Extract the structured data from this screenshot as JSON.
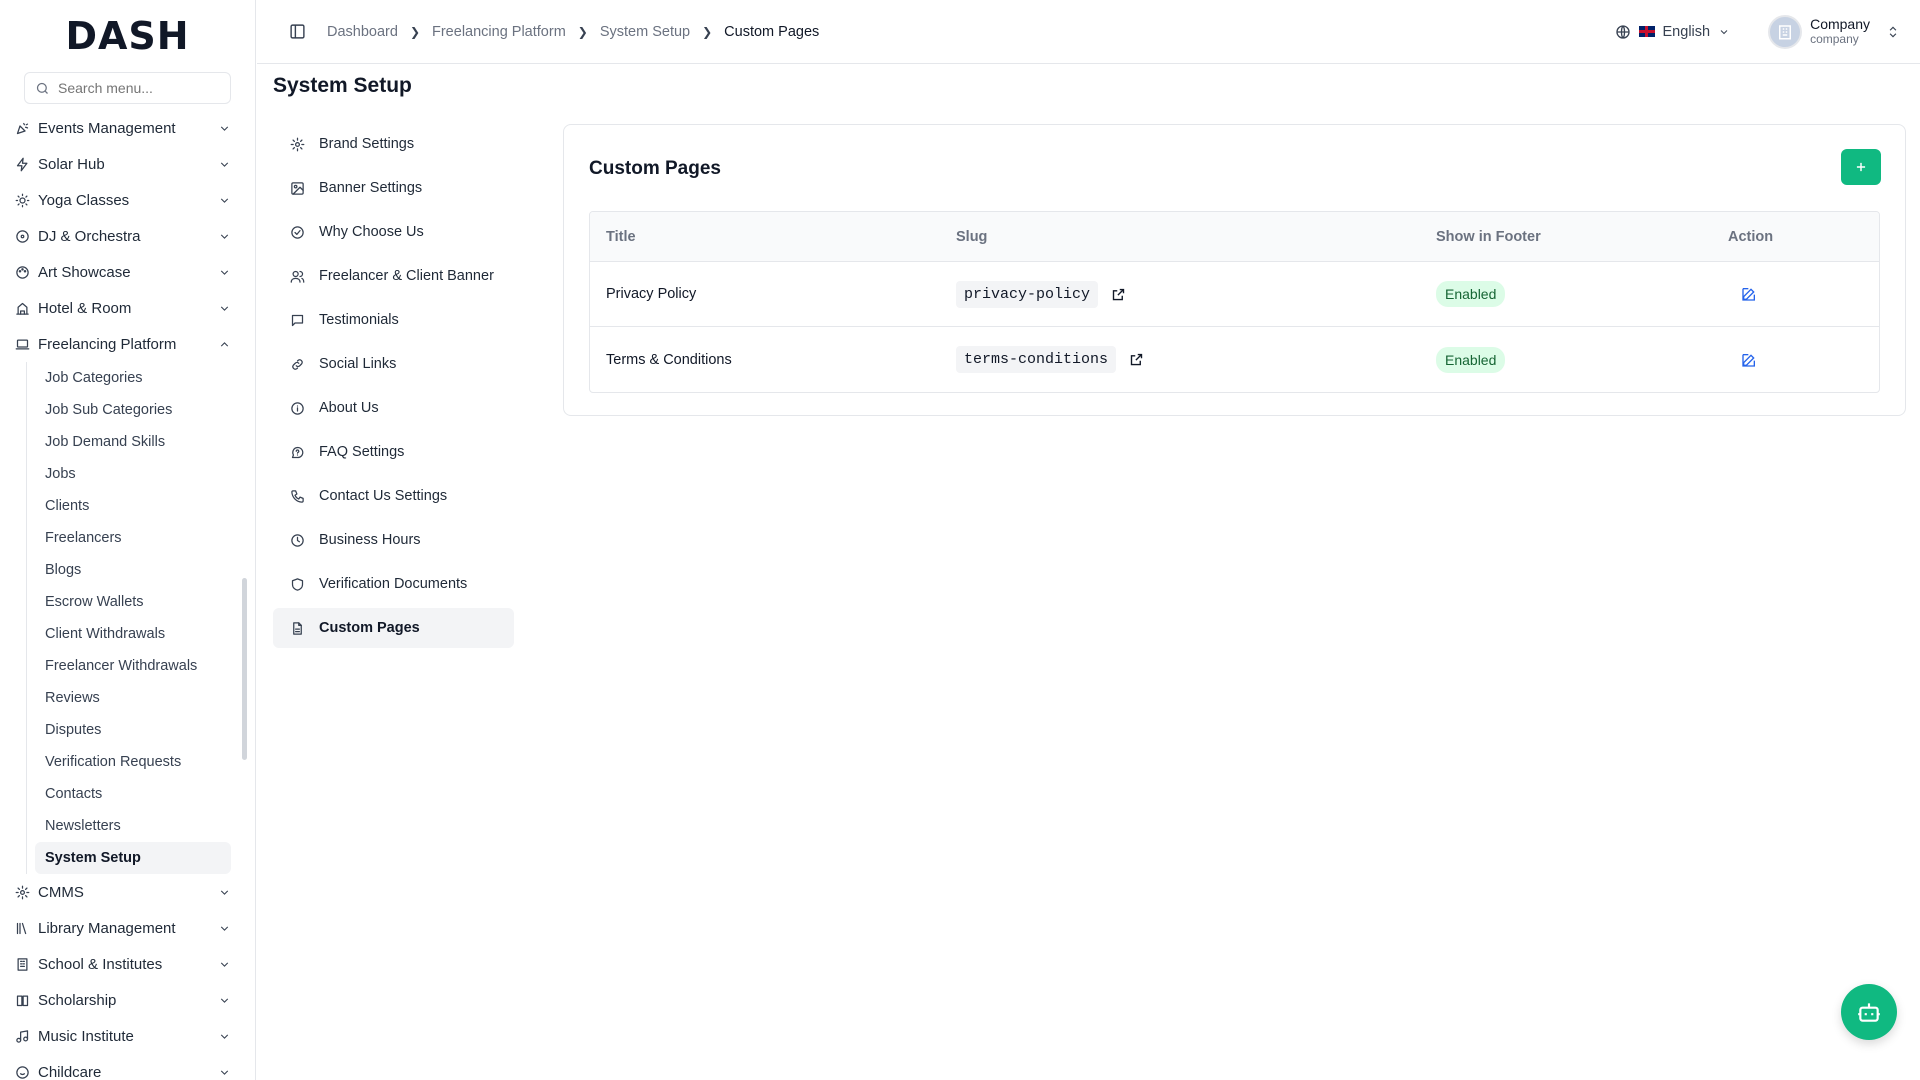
{
  "app": {
    "logo": "DASH"
  },
  "search": {
    "placeholder": "Search menu..."
  },
  "sidebar": {
    "items_top": [
      {
        "label": "Events Management",
        "icon": "party-icon"
      },
      {
        "label": "Solar Hub",
        "icon": "bolt-icon"
      },
      {
        "label": "Yoga Classes",
        "icon": "sun-icon"
      },
      {
        "label": "DJ & Orchestra",
        "icon": "disc-icon"
      },
      {
        "label": "Art Showcase",
        "icon": "palette-icon"
      },
      {
        "label": "Hotel & Room",
        "icon": "hotel-icon"
      }
    ],
    "expanded": {
      "label": "Freelancing Platform",
      "icon": "laptop-icon"
    },
    "sub_items": [
      "Job Categories",
      "Job Sub Categories",
      "Job Demand Skills",
      "Jobs",
      "Clients",
      "Freelancers",
      "Blogs",
      "Escrow Wallets",
      "Client Withdrawals",
      "Freelancer Withdrawals",
      "Reviews",
      "Disputes",
      "Verification Requests",
      "Contacts",
      "Newsletters",
      "System Setup"
    ],
    "active_sub": "System Setup",
    "items_bottom": [
      {
        "label": "CMMS",
        "icon": "cog-icon"
      },
      {
        "label": "Library Management",
        "icon": "library-icon"
      },
      {
        "label": "School & Institutes",
        "icon": "building-icon"
      },
      {
        "label": "Scholarship",
        "icon": "book-icon"
      },
      {
        "label": "Music Institute",
        "icon": "music-icon"
      },
      {
        "label": "Childcare",
        "icon": "baby-icon"
      }
    ]
  },
  "breadcrumb": [
    "Dashboard",
    "Freelancing Platform",
    "System Setup",
    "Custom Pages"
  ],
  "header": {
    "language": "English",
    "user_name": "Company",
    "user_role": "company"
  },
  "page": {
    "title": "System Setup"
  },
  "settings_menu": [
    {
      "label": "Brand Settings",
      "icon": "gear-icon"
    },
    {
      "label": "Banner Settings",
      "icon": "image-icon"
    },
    {
      "label": "Why Choose Us",
      "icon": "check-circle-icon"
    },
    {
      "label": "Freelancer & Client Banner",
      "icon": "users-icon"
    },
    {
      "label": "Testimonials",
      "icon": "message-icon"
    },
    {
      "label": "Social Links",
      "icon": "link-icon"
    },
    {
      "label": "About Us",
      "icon": "info-icon"
    },
    {
      "label": "FAQ Settings",
      "icon": "help-icon"
    },
    {
      "label": "Contact Us Settings",
      "icon": "phone-icon"
    },
    {
      "label": "Business Hours",
      "icon": "clock-icon"
    },
    {
      "label": "Verification Documents",
      "icon": "shield-icon"
    },
    {
      "label": "Custom Pages",
      "icon": "file-icon"
    }
  ],
  "active_setting": "Custom Pages",
  "card": {
    "title": "Custom Pages",
    "columns": [
      "Title",
      "Slug",
      "Show in Footer",
      "Action"
    ],
    "rows": [
      {
        "title": "Privacy Policy",
        "slug": "privacy-policy",
        "footer": "Enabled"
      },
      {
        "title": "Terms & Conditions",
        "slug": "terms-conditions",
        "footer": "Enabled"
      }
    ]
  },
  "colors": {
    "accent": "#10b981",
    "badge_bg": "#dcfce7",
    "badge_text": "#166534",
    "edit_icon": "#2563eb"
  }
}
